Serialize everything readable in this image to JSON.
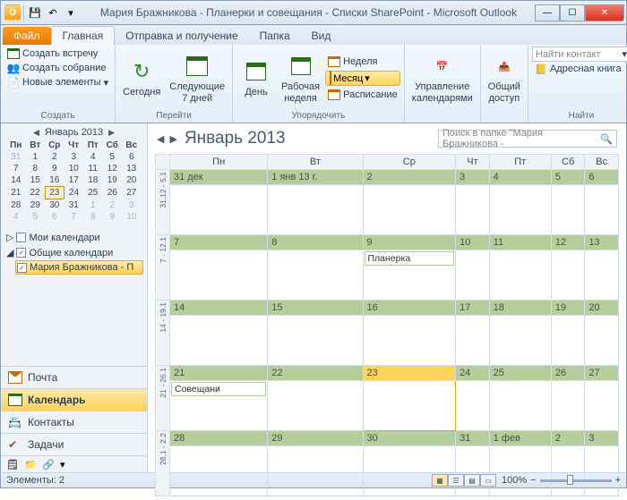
{
  "window": {
    "title": "Мария Бражникова - Планерки и совещания - Списки SharePoint  -  Microsoft Outlook"
  },
  "ribbon": {
    "file": "Файл",
    "tabs": [
      "Главная",
      "Отправка и получение",
      "Папка",
      "Вид"
    ],
    "group_create": {
      "items": [
        "Создать встречу",
        "Создать собрание",
        "Новые элементы"
      ],
      "label": "Создать"
    },
    "group_goto": {
      "today": "Сегодня",
      "next7": "Следующие\n7 дней",
      "label": "Перейти"
    },
    "group_arrange": {
      "day": "День",
      "workweek": "Рабочая\nнеделя",
      "week": "Неделя",
      "month": "Месяц",
      "schedule": "Расписание",
      "label": "Упорядочить"
    },
    "group_manage": {
      "btn": "Управление\nкалендарями",
      "label": ""
    },
    "group_share": {
      "btn": "Общий\nдоступ",
      "label": ""
    },
    "group_find": {
      "find_contact": "Найти контакт",
      "address_book": "Адресная книга",
      "label": "Найти"
    }
  },
  "minical": {
    "title": "Январь 2013",
    "dow": [
      "Пн",
      "Вт",
      "Ср",
      "Чт",
      "Пт",
      "Сб",
      "Вс"
    ],
    "weeks": [
      [
        {
          "d": "31",
          "dim": true
        },
        {
          "d": "1"
        },
        {
          "d": "2"
        },
        {
          "d": "3"
        },
        {
          "d": "4"
        },
        {
          "d": "5"
        },
        {
          "d": "6"
        }
      ],
      [
        {
          "d": "7"
        },
        {
          "d": "8"
        },
        {
          "d": "9"
        },
        {
          "d": "10"
        },
        {
          "d": "11"
        },
        {
          "d": "12"
        },
        {
          "d": "13"
        }
      ],
      [
        {
          "d": "14"
        },
        {
          "d": "15"
        },
        {
          "d": "16"
        },
        {
          "d": "17"
        },
        {
          "d": "18"
        },
        {
          "d": "19"
        },
        {
          "d": "20"
        }
      ],
      [
        {
          "d": "21"
        },
        {
          "d": "22"
        },
        {
          "d": "23",
          "today": true
        },
        {
          "d": "24"
        },
        {
          "d": "25"
        },
        {
          "d": "26"
        },
        {
          "d": "27"
        }
      ],
      [
        {
          "d": "28"
        },
        {
          "d": "29"
        },
        {
          "d": "30"
        },
        {
          "d": "31"
        },
        {
          "d": "1",
          "dim": true
        },
        {
          "d": "2",
          "dim": true
        },
        {
          "d": "3",
          "dim": true
        }
      ],
      [
        {
          "d": "4",
          "dim": true
        },
        {
          "d": "5",
          "dim": true
        },
        {
          "d": "6",
          "dim": true
        },
        {
          "d": "7",
          "dim": true
        },
        {
          "d": "8",
          "dim": true
        },
        {
          "d": "9",
          "dim": true
        },
        {
          "d": "10",
          "dim": true
        }
      ]
    ]
  },
  "tree": {
    "my": "Мои календари",
    "shared": "Общие календари",
    "item": "Мария Бражникова - П"
  },
  "nav": {
    "mail": "Почта",
    "calendar": "Календарь",
    "contacts": "Контакты",
    "tasks": "Задачи"
  },
  "cal": {
    "title": "Январь 2013",
    "search_ph": "Поиск в папке \"Мария Бражникова -",
    "dow": [
      "Пн",
      "Вт",
      "Ср",
      "Чт",
      "Пт",
      "Сб",
      "Вс"
    ],
    "rows": [
      {
        "wk": "31.12 - 5.1",
        "dates": [
          "31 дек",
          "1 янв 13 г.",
          "2",
          "3",
          "4",
          "5",
          "6"
        ],
        "events": {}
      },
      {
        "wk": "7 - 12.1",
        "dates": [
          "7",
          "8",
          "9",
          "10",
          "11",
          "12",
          "13"
        ],
        "events": {
          "2": "Планерка"
        }
      },
      {
        "wk": "14 - 19.1",
        "dates": [
          "14",
          "15",
          "16",
          "17",
          "18",
          "19",
          "20"
        ],
        "events": {}
      },
      {
        "wk": "21 - 26.1",
        "dates": [
          "21",
          "22",
          "23",
          "24",
          "25",
          "26",
          "27"
        ],
        "events": {
          "0": "Совещани"
        },
        "today": 2
      },
      {
        "wk": "28.1 - 2.2",
        "dates": [
          "28",
          "29",
          "30",
          "31",
          "1 фев",
          "2",
          "3"
        ],
        "events": {}
      }
    ]
  },
  "status": {
    "items": "Элементы: 2",
    "zoom": "100%"
  }
}
